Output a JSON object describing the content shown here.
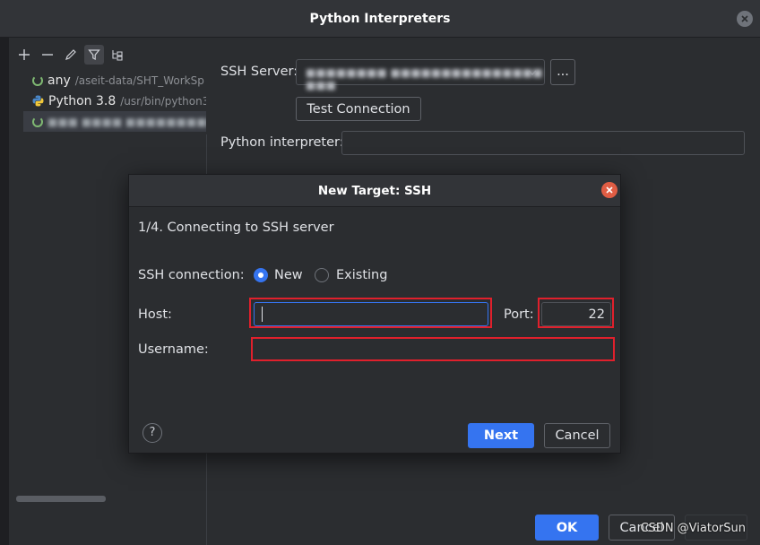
{
  "window": {
    "title": "Python Interpreters"
  },
  "toolbar": {
    "icons": [
      "plus-icon",
      "minus-icon",
      "pencil-icon",
      "filter-icon",
      "tree-icon"
    ]
  },
  "interpreters": [
    {
      "name": "any",
      "path": "/aseit-data/SHT_WorkSp",
      "icon": "loading-icon"
    },
    {
      "name": "Python 3.8",
      "path": "/usr/bin/python3",
      "icon": "python-icon"
    },
    {
      "name": "",
      "path": "",
      "icon": "loading-icon",
      "redacted": true
    }
  ],
  "main": {
    "ssh_server_label": "SSH Server:",
    "browse_label": "...",
    "test_connection_label": "Test Connection",
    "python_interpreter_label": "Python interpreter:",
    "python_interpreter_value": ""
  },
  "dialog": {
    "title": "New Target: SSH",
    "step": "1/4. Connecting to SSH server",
    "ssh_connection_label": "SSH connection:",
    "option_new": "New",
    "option_existing": "Existing",
    "selected": "New",
    "host_label": "Host:",
    "host_value": "",
    "port_label": "Port:",
    "port_value": "22",
    "username_label": "Username:",
    "username_value": "",
    "help_label": "?",
    "next_label": "Next",
    "cancel_label": "Cancel"
  },
  "footer": {
    "ok_label": "OK",
    "cancel_label": "Cancel"
  },
  "watermark": "CSDN @ViatorSun",
  "colors": {
    "accent": "#3574f0",
    "highlight": "#e0202c",
    "background": "#2b2d30",
    "close": "#e05d44"
  }
}
